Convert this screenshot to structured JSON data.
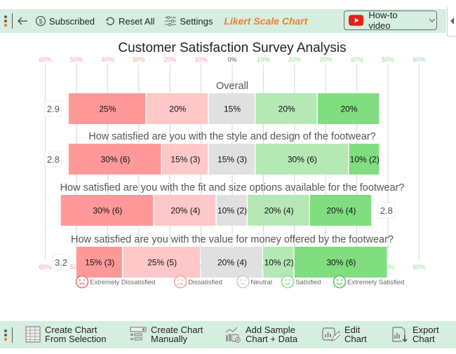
{
  "top_toolbar": {
    "back_icon": "arrow-left-icon",
    "subscribed_label": "Subscribed",
    "reset_label": "Reset All",
    "settings_label": "Settings",
    "brand_label": "Likert Scale Chart",
    "video_label": "How-to video"
  },
  "bottom_toolbar": {
    "items": [
      {
        "line1": "Create Chart",
        "line2": "From Selection",
        "icon": "table-grid-icon"
      },
      {
        "line1": "Create Chart",
        "line2": "Manually",
        "icon": "form-list-icon"
      },
      {
        "line1": "Add Sample",
        "line2": "Chart + Data",
        "icon": "sample-data-icon"
      },
      {
        "line1": "Edit",
        "line2": "Chart",
        "icon": "edit-chart-icon"
      },
      {
        "line1": "Export",
        "line2": "Chart",
        "icon": "export-chart-icon"
      }
    ]
  },
  "colors": {
    "extremely_dissatisfied": "#ff9999",
    "dissatisfied": "#ffc8c8",
    "neutral": "#e0e0e0",
    "satisfied": "#b5e8b5",
    "extremely_satisfied": "#80dd80",
    "neg_tick": "#ff9b9b",
    "pos_tick": "#8fdf8f",
    "zero_tick": "#555555",
    "toolbar_bg": "#d5eee0",
    "brand": "#f07d2c"
  },
  "chart_data": {
    "type": "bar",
    "subtype": "diverging-stacked-likert",
    "title": "Customer Satisfaction Survey Analysis",
    "xlim": [
      -60,
      60
    ],
    "ticks": [
      -60,
      -50,
      -40,
      -30,
      -20,
      -10,
      0,
      10,
      20,
      30,
      40,
      50,
      60
    ],
    "tick_labels": [
      "60%",
      "50%",
      "40%",
      "30%",
      "20%",
      "10%",
      "0%",
      "10%",
      "20%",
      "30%",
      "40%",
      "50%",
      "60%"
    ],
    "grid": true,
    "legend_position": "bottom",
    "legend": [
      "Extremely Dissatisfied",
      "Dissatisfied",
      "Neutral",
      "Satisfied",
      "Extremely Satisfied"
    ],
    "categories": [
      "Overall",
      "How satisfied are you with the style and design of the footwear?",
      "How satisfied are you with the fit and size options available for the footwear?",
      "How satisfied are you with the value for money offered by the footwear?"
    ],
    "series": [
      {
        "name": "Extremely Dissatisfied",
        "values": [
          25,
          30,
          30,
          15
        ],
        "counts": [
          null,
          6,
          6,
          3
        ]
      },
      {
        "name": "Dissatisfied",
        "values": [
          20,
          15,
          20,
          25
        ],
        "counts": [
          null,
          3,
          4,
          5
        ]
      },
      {
        "name": "Neutral",
        "values": [
          15,
          15,
          10,
          20
        ],
        "counts": [
          null,
          3,
          2,
          4
        ]
      },
      {
        "name": "Satisfied",
        "values": [
          20,
          30,
          20,
          10
        ],
        "counts": [
          null,
          6,
          4,
          2
        ]
      },
      {
        "name": "Extremely Satisfied",
        "values": [
          20,
          10,
          20,
          30
        ],
        "counts": [
          null,
          2,
          4,
          6
        ]
      }
    ],
    "scores": [
      "2.9",
      "2.8",
      "2.8",
      "3.2"
    ],
    "score_side": [
      "left",
      "left",
      "right",
      "left"
    ]
  }
}
